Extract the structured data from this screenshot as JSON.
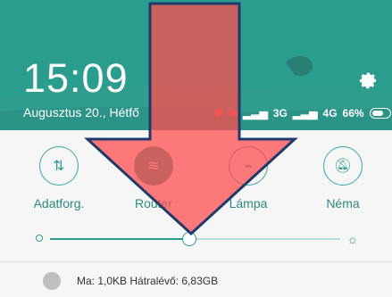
{
  "header": {
    "time": "15:09",
    "date": "Augusztus 20., Hétfő",
    "network_label_1": "3G",
    "network_label_2": "4G",
    "battery_percent": "66%",
    "colors": {
      "bg": "#2a9d8f",
      "accent": "#ffffff",
      "alert": "#ff5757"
    }
  },
  "toggles": [
    {
      "label": "Adatforg.",
      "icon": "data-transfer-icon"
    },
    {
      "label": "Router",
      "icon": "wifi-router-icon",
      "active": true
    },
    {
      "label": "Lámpa",
      "icon": "flashlight-icon"
    },
    {
      "label": "Néma",
      "icon": "bell-off-icon"
    }
  ],
  "brightness": {
    "level_fraction": 0.43
  },
  "data_usage": {
    "text": "Ma: 1,0KB  Hátralévő: 6,83GB"
  }
}
